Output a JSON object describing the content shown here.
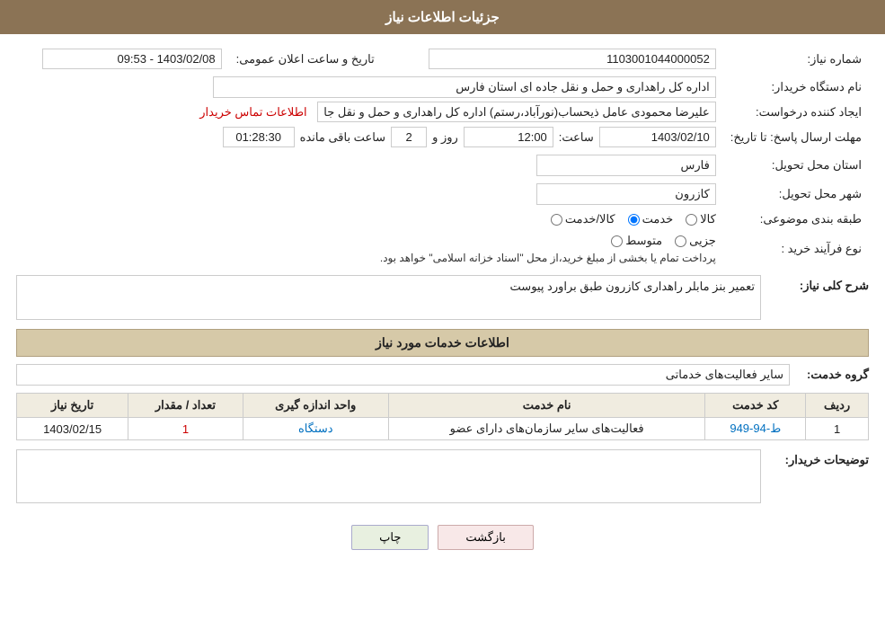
{
  "header": {
    "title": "جزئیات اطلاعات نیاز"
  },
  "fields": {
    "need_number_label": "شماره نیاز:",
    "need_number_value": "1103001044000052",
    "announce_datetime_label": "تاریخ و ساعت اعلان عمومی:",
    "announce_datetime_value": "1403/02/08 - 09:53",
    "buyer_org_label": "نام دستگاه خریدار:",
    "buyer_org_value": "اداره کل راهداری و حمل و نقل جاده ای استان فارس",
    "creator_label": "ایجاد کننده درخواست:",
    "creator_value": "علیرضا محمودی عامل ذیحساب(نورآباد،رستم) اداره کل راهداری و حمل و نقل جا",
    "creator_link": "اطلاعات تماس خریدار",
    "response_deadline_label": "مهلت ارسال پاسخ: تا تاریخ:",
    "response_date_value": "1403/02/10",
    "response_time_label": "ساعت:",
    "response_time_value": "12:00",
    "response_days_label": "روز و",
    "response_days_value": "2",
    "response_remaining_label": "ساعت باقی مانده",
    "response_remaining_value": "01:28:30",
    "province_label": "استان محل تحویل:",
    "province_value": "فارس",
    "city_label": "شهر محل تحویل:",
    "city_value": "کازرون",
    "category_label": "طبقه بندی موضوعی:",
    "category_options": [
      "کالا",
      "خدمت",
      "کالا/خدمت"
    ],
    "category_selected": "خدمت",
    "purchase_type_label": "نوع فرآیند خرید :",
    "purchase_options": [
      "جزیی",
      "متوسط"
    ],
    "purchase_note": "پرداخت تمام یا بخشی از مبلغ خرید،از محل \"اسناد خزانه اسلامی\" خواهد بود.",
    "need_desc_label": "شرح کلی نیاز:",
    "need_desc_value": "تعمیر بنز مابلر راهداری کازرون طبق براورد پیوست",
    "services_section_label": "اطلاعات خدمات مورد نیاز",
    "service_group_label": "گروه خدمت:",
    "service_group_value": "سایر فعالیت‌های خدماتی",
    "table": {
      "headers": [
        "ردیف",
        "کد خدمت",
        "نام خدمت",
        "واحد اندازه گیری",
        "تعداد / مقدار",
        "تاریخ نیاز"
      ],
      "rows": [
        {
          "row": "1",
          "code": "ط-94-949",
          "name": "فعالیت‌های سایر سازمان‌های دارای عضو",
          "unit": "دستگاه",
          "quantity": "1",
          "date": "1403/02/15"
        }
      ]
    },
    "buyer_desc_label": "توضیحات خریدار:",
    "buyer_desc_value": ""
  },
  "buttons": {
    "print": "چاپ",
    "back": "بازگشت"
  }
}
